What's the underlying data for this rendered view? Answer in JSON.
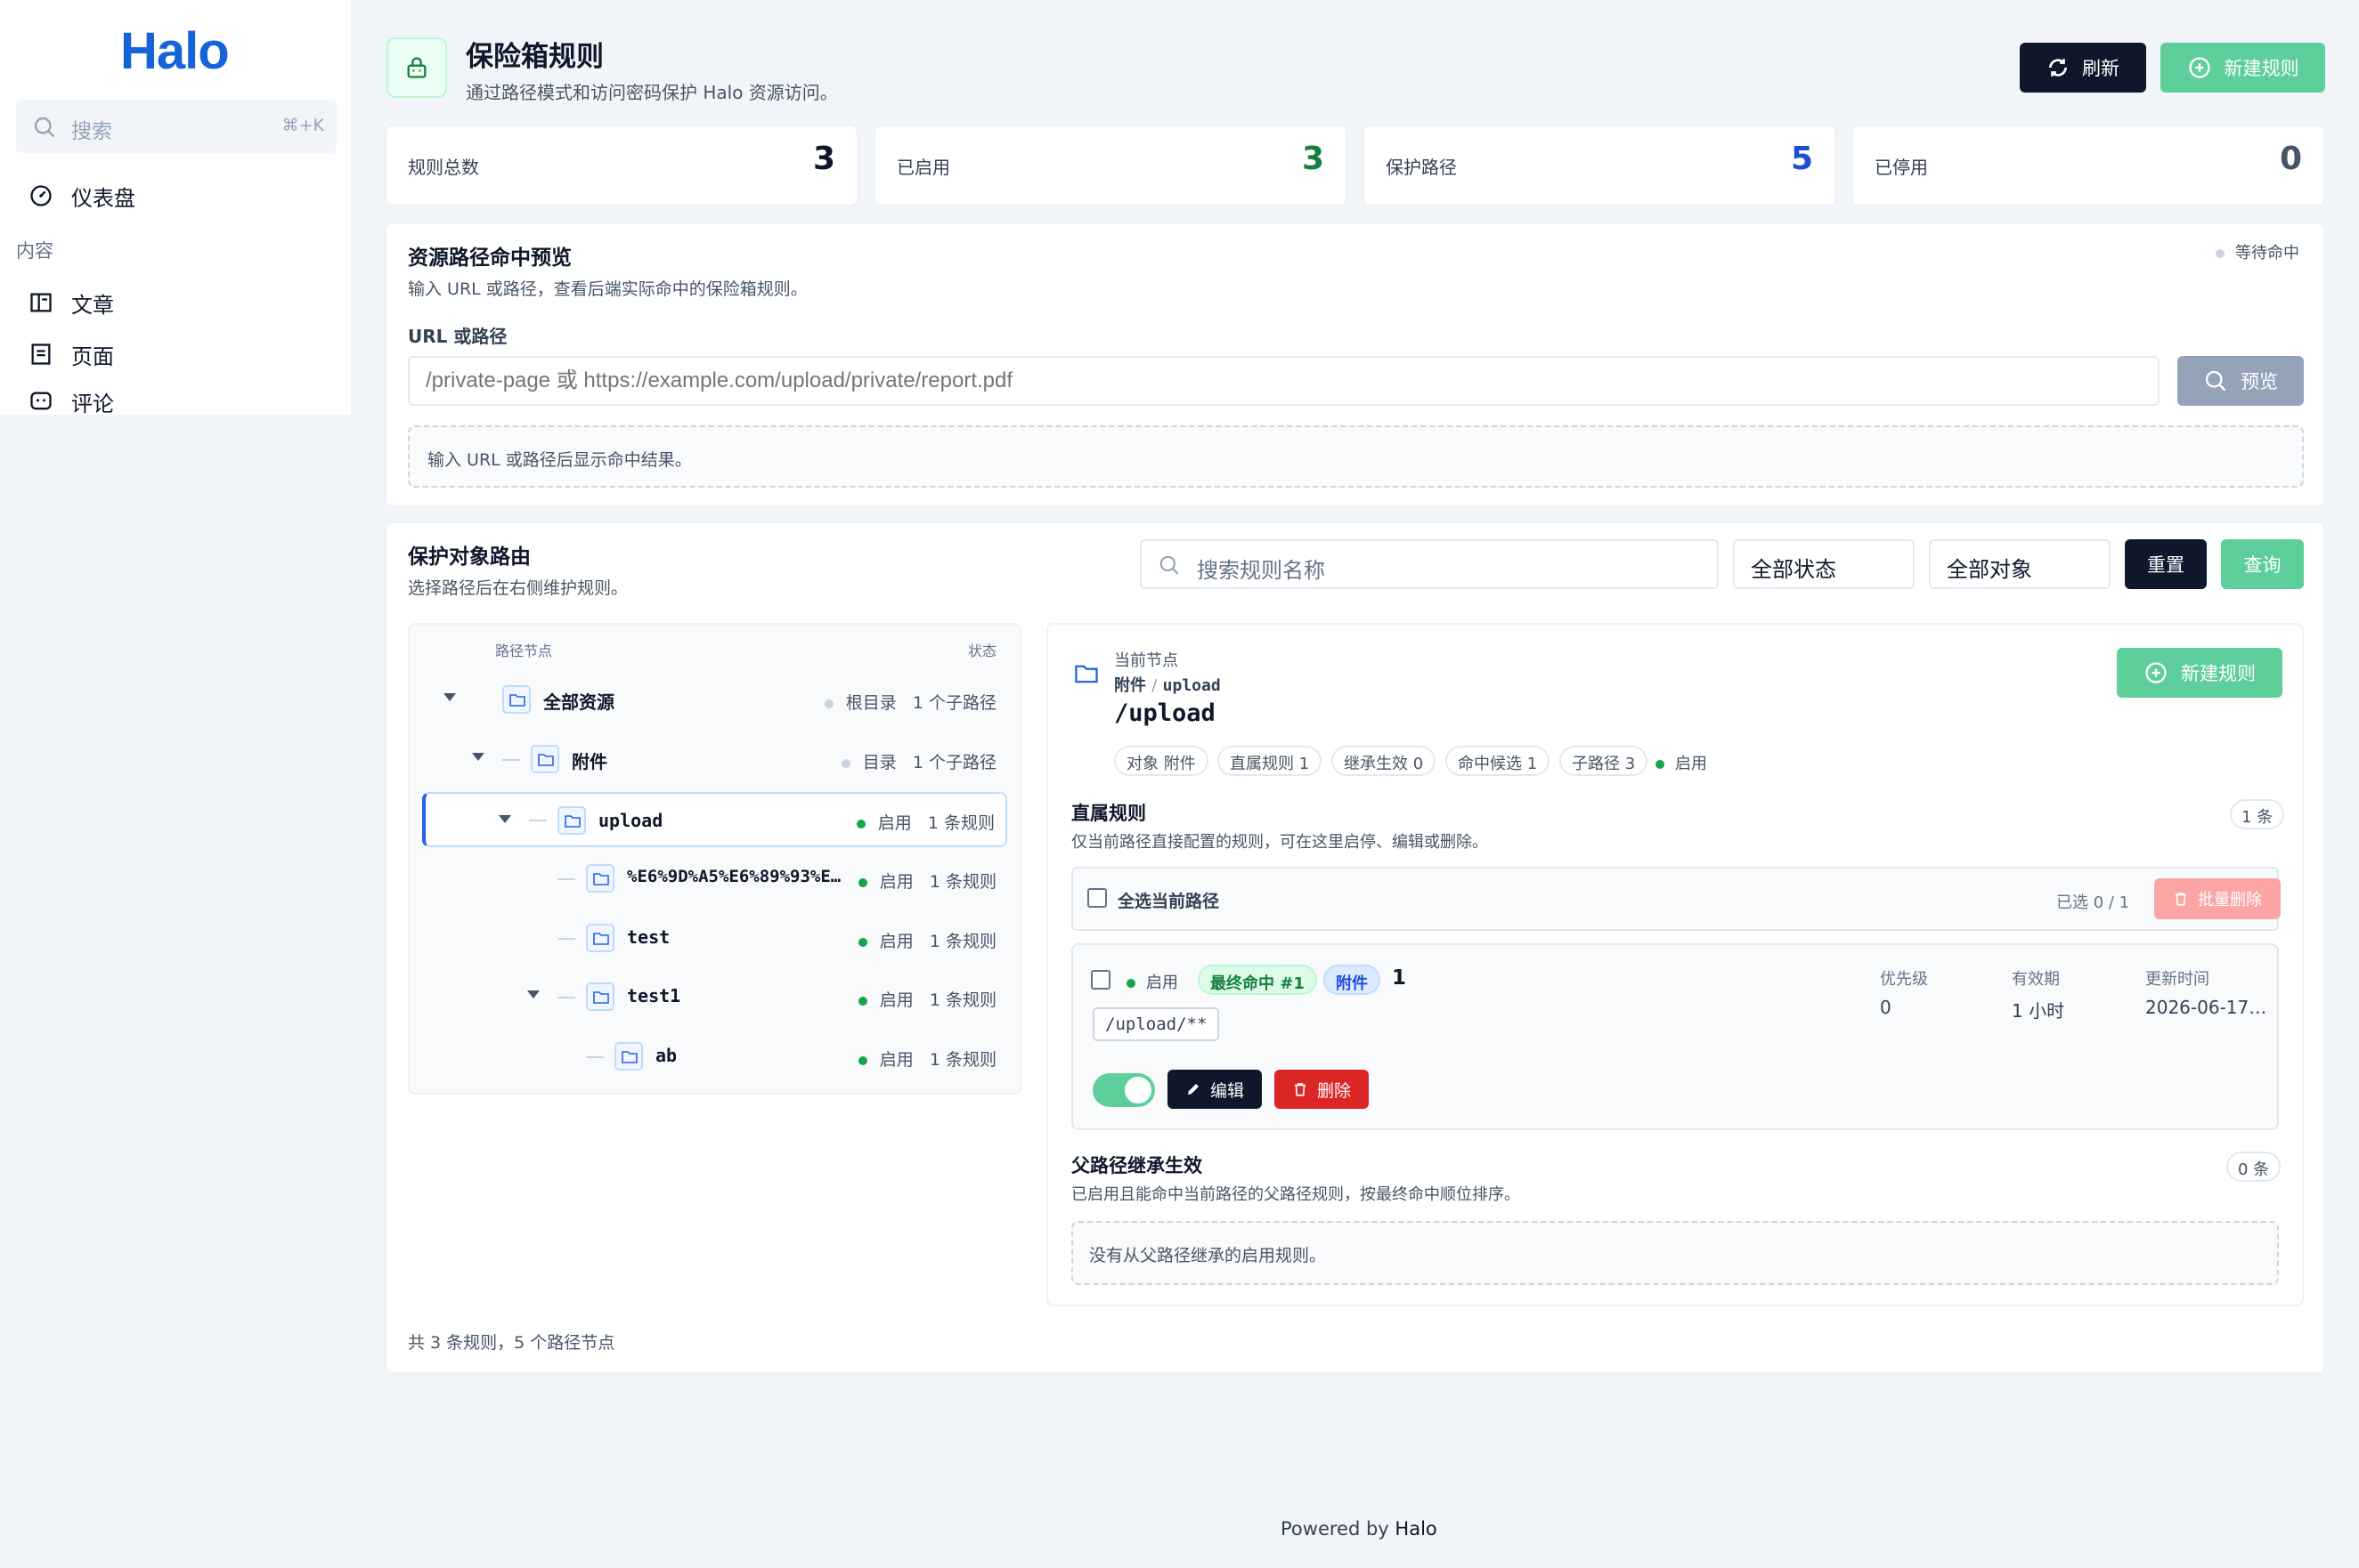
{
  "sidebar": {
    "logo": "Halo",
    "search_placeholder": "搜索",
    "search_shortcut": "⌘+K",
    "dashboard": "仪表盘",
    "group_content": "内容",
    "items": [
      "文章",
      "页面",
      "评论"
    ]
  },
  "header": {
    "title": "保险箱规则",
    "subtitle": "通过路径模式和访问密码保护 Halo 资源访问。",
    "refresh_label": "刷新",
    "new_rule_label": "新建规则"
  },
  "stats": [
    {
      "label": "规则总数",
      "value": "3",
      "color": "#0f172a"
    },
    {
      "label": "已启用",
      "value": "3",
      "color": "#15803d"
    },
    {
      "label": "保护路径",
      "value": "5",
      "color": "#1d4ed8"
    },
    {
      "label": "已停用",
      "value": "0",
      "color": "#475569"
    }
  ],
  "preview": {
    "title": "资源路径命中预览",
    "subtitle": "输入 URL 或路径，查看后端实际命中的保险箱规则。",
    "status": "等待命中",
    "field_label": "URL 或路径",
    "placeholder": "/private-page 或 https://example.com/upload/private/report.pdf",
    "button": "预览",
    "result_hint": "输入 URL 或路径后显示命中结果。"
  },
  "routes": {
    "title": "保护对象路由",
    "subtitle": "选择路径后在右侧维护规则。",
    "search_placeholder": "搜索规则名称",
    "status_filter": "全部状态",
    "object_filter": "全部对象",
    "reset": "重置",
    "query": "查询",
    "tree_header_node": "路径节点",
    "tree_header_status": "状态",
    "tree": [
      {
        "name": "全部资源",
        "status": "根目录",
        "count": "1 个子路径",
        "state": "neutral",
        "mono": false
      },
      {
        "name": "附件",
        "status": "目录",
        "count": "1 个子路径",
        "state": "neutral",
        "mono": false
      },
      {
        "name": "upload",
        "status": "启用",
        "count": "1 条规则",
        "state": "on",
        "mono": true
      },
      {
        "name": "%E6%9D%A5%E6%89%93%E…",
        "status": "启用",
        "count": "1 条规则",
        "state": "on",
        "mono": true
      },
      {
        "name": "test",
        "status": "启用",
        "count": "1 条规则",
        "state": "on",
        "mono": true
      },
      {
        "name": "test1",
        "status": "启用",
        "count": "1 条规则",
        "state": "on",
        "mono": true
      },
      {
        "name": "ab",
        "status": "启用",
        "count": "1 条规则",
        "state": "on",
        "mono": true
      }
    ],
    "footer": "共 3 条规则，5 个路径节点"
  },
  "detail": {
    "current_label": "当前节点",
    "crumb_parent": "附件",
    "crumb_sep": "/",
    "crumb_current": "upload",
    "path": "/upload",
    "new_rule": "新建规则",
    "chips": [
      "对象 附件",
      "直属规则 1",
      "继承生效 0",
      "命中候选 1",
      "子路径 3"
    ],
    "enabled": "启用",
    "direct_title": "直属规则",
    "direct_sub": "仅当前路径直接配置的规则，可在这里启停、编辑或删除。",
    "direct_count": "1 条",
    "select_all": "全选当前路径",
    "selected": "已选 0 / 1",
    "batch_delete": "批量删除",
    "rule": {
      "status": "启用",
      "badge_hit": "最终命中 #1",
      "badge_obj": "附件",
      "name": "1",
      "pattern": "/upload/**",
      "priority_label": "优先级",
      "priority": "0",
      "expiry_label": "有效期",
      "expiry": "1 小时",
      "updated_label": "更新时间",
      "updated": "2026-06-17…",
      "edit": "编辑",
      "delete": "删除",
      "enabled": true
    },
    "inherit_title": "父路径继承生效",
    "inherit_sub": "已启用且能命中当前路径的父路径规则，按最终命中顺位排序。",
    "inherit_count": "0 条",
    "inherit_empty": "没有从父路径继承的启用规则。"
  },
  "footer": {
    "powered": "Powered by",
    "brand": "Halo"
  }
}
